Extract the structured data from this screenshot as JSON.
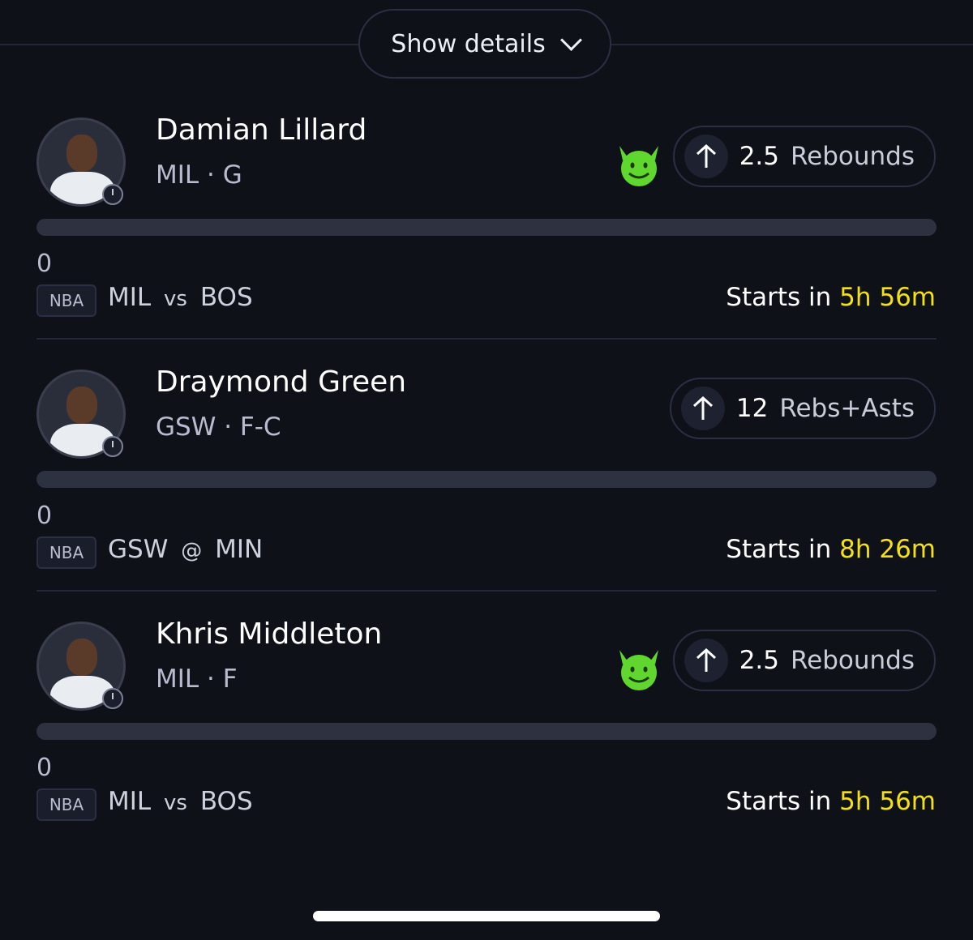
{
  "header": {
    "details_label": "Show details"
  },
  "picks": [
    {
      "player": "Damian Lillard",
      "meta": "MIL · G",
      "devil": true,
      "line": "2.5",
      "stat": "Rebounds",
      "progress": 0,
      "current": "0",
      "league": "NBA",
      "team1": "MIL",
      "sep": "vs",
      "team2": "BOS",
      "starts_label": "Starts in",
      "starts_time": "5h 56m"
    },
    {
      "player": "Draymond Green",
      "meta": "GSW · F-C",
      "devil": false,
      "line": "12",
      "stat": "Rebs+Asts",
      "progress": 0,
      "current": "0",
      "league": "NBA",
      "team1": "GSW",
      "sep": "@",
      "team2": "MIN",
      "starts_label": "Starts in",
      "starts_time": "8h 26m"
    },
    {
      "player": "Khris Middleton",
      "meta": "MIL · F",
      "devil": true,
      "line": "2.5",
      "stat": "Rebounds",
      "progress": 0,
      "current": "0",
      "league": "NBA",
      "team1": "MIL",
      "sep": "vs",
      "team2": "BOS",
      "starts_label": "Starts in",
      "starts_time": "5h 56m"
    }
  ],
  "colors": {
    "background": "#0f1119",
    "accent_time": "#f2e018",
    "devil_green": "#5fd72e",
    "track": "#2e3140"
  },
  "icons": {
    "details": "chevron-down-icon",
    "direction": "arrow-up-icon",
    "badge": "devil-emoji-icon",
    "status": "clock-icon"
  }
}
